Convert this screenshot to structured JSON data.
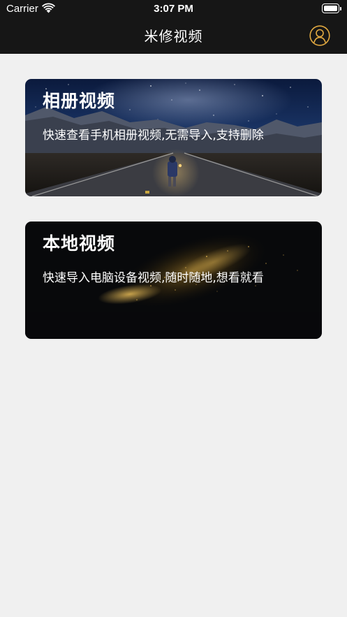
{
  "status_bar": {
    "carrier": "Carrier",
    "time": "3:07 PM",
    "icons": [
      "wifi-icon",
      "battery-icon"
    ]
  },
  "nav": {
    "title": "米修视频",
    "profile_icon": "user-profile-icon"
  },
  "cards": [
    {
      "title": "相册视频",
      "description": "快速查看手机相册视频,无需导入,支持删除"
    },
    {
      "title": "本地视频",
      "description": "快速导入电脑设备视频,随时随地,想看就看"
    }
  ],
  "colors": {
    "top_bar": "#161616",
    "background": "#f0f0f0",
    "profile_accent": "#e0a840"
  }
}
